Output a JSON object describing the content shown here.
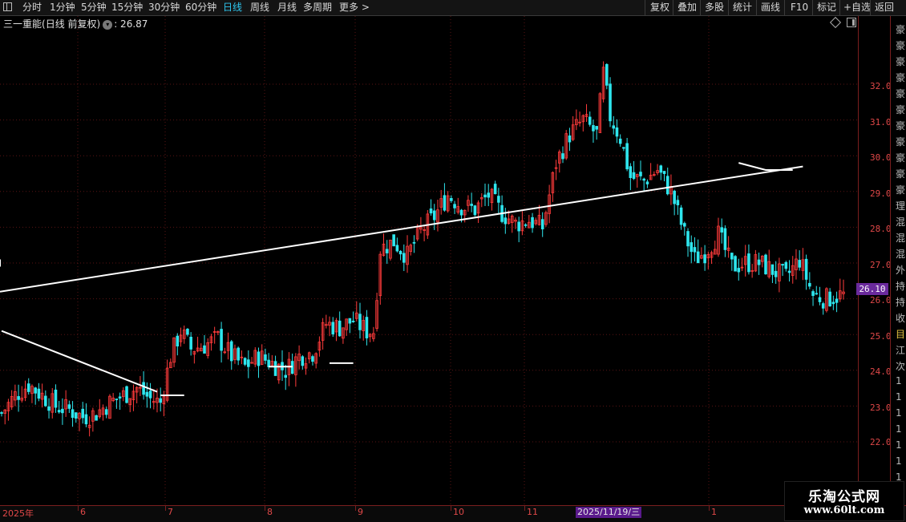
{
  "toolbar": {
    "periods": [
      "分时",
      "1分钟",
      "5分钟",
      "15分钟",
      "30分钟",
      "60分钟",
      "日线",
      "周线",
      "月线",
      "多周期",
      "更多 >"
    ],
    "active_period": "日线",
    "actions": [
      "复权",
      "叠加",
      "多股",
      "统计",
      "画线",
      "F10",
      "标记",
      "+自选",
      "返回"
    ]
  },
  "header": {
    "stock_name": "三一重能",
    "period_label": "(日线 前复权)",
    "current_value": ": 26.87"
  },
  "y_axis": {
    "labels": [
      "32.00",
      "31.00",
      "30.00",
      "29.00",
      "28.00",
      "27.00",
      "26.00",
      "25.00",
      "24.00",
      "23.00",
      "22.00"
    ]
  },
  "price_tag": "26.10",
  "x_axis": {
    "labels": [
      "2025年",
      "6",
      "7",
      "8",
      "9",
      "10",
      "11",
      "1"
    ],
    "highlight_date": "2025/11/19/三"
  },
  "watermark": {
    "title": "乐淘公式网",
    "url": "www.60lt.com"
  },
  "colors": {
    "up": "#ff3b3b",
    "down": "#2ee6ee",
    "line": "#ffffff",
    "grid": "#5a1414",
    "axis": "#e04848",
    "active": "#2ec7f0"
  },
  "chart_data": {
    "type": "candlestick",
    "ylim": [
      21.1,
      33.5
    ],
    "count": 250,
    "anchors": [
      [
        0,
        22.8
      ],
      [
        4,
        23.3
      ],
      [
        8,
        23.6
      ],
      [
        12,
        23.3
      ],
      [
        16,
        23.0
      ],
      [
        20,
        22.9
      ],
      [
        24,
        22.7
      ],
      [
        28,
        22.8
      ],
      [
        32,
        23.1
      ],
      [
        36,
        23.3
      ],
      [
        40,
        23.5
      ],
      [
        44,
        23.2
      ],
      [
        47,
        23.1
      ],
      [
        50,
        24.4
      ],
      [
        53,
        25.1
      ],
      [
        56,
        24.6
      ],
      [
        60,
        24.7
      ],
      [
        64,
        24.9
      ],
      [
        68,
        24.4
      ],
      [
        72,
        24.1
      ],
      [
        76,
        24.4
      ],
      [
        80,
        24.2
      ],
      [
        84,
        24.0
      ],
      [
        88,
        24.4
      ],
      [
        92,
        24.5
      ],
      [
        96,
        25.3
      ],
      [
        100,
        25.2
      ],
      [
        104,
        25.4
      ],
      [
        108,
        25.1
      ],
      [
        110,
        25.1
      ],
      [
        112,
        27.4
      ],
      [
        116,
        27.6
      ],
      [
        120,
        27.2
      ],
      [
        124,
        27.9
      ],
      [
        128,
        28.3
      ],
      [
        132,
        28.9
      ],
      [
        136,
        28.6
      ],
      [
        140,
        28.5
      ],
      [
        144,
        28.9
      ],
      [
        148,
        28.4
      ],
      [
        152,
        28.1
      ],
      [
        156,
        28.2
      ],
      [
        160,
        28.0
      ],
      [
        164,
        29.8
      ],
      [
        168,
        30.6
      ],
      [
        172,
        31.0
      ],
      [
        176,
        30.6
      ],
      [
        178,
        32.3
      ],
      [
        180,
        31.1
      ],
      [
        183,
        30.5
      ],
      [
        186,
        29.4
      ],
      [
        190,
        29.3
      ],
      [
        194,
        29.6
      ],
      [
        198,
        29.0
      ],
      [
        202,
        27.8
      ],
      [
        205,
        27.1
      ],
      [
        208,
        27.3
      ],
      [
        212,
        27.8
      ],
      [
        216,
        26.9
      ],
      [
        220,
        27.0
      ],
      [
        224,
        27.0
      ],
      [
        228,
        26.8
      ],
      [
        232,
        26.6
      ],
      [
        236,
        27.1
      ],
      [
        240,
        26.1
      ],
      [
        244,
        26.0
      ],
      [
        248,
        26.1
      ],
      [
        249,
        26.1
      ]
    ],
    "lines": [
      {
        "name": "segment-1",
        "points": [
          [
            0,
            25.1
          ],
          [
            46,
            23.4
          ]
        ]
      },
      {
        "name": "segment-2",
        "points": [
          [
            47,
            23.3
          ],
          [
            54,
            23.3
          ]
        ]
      },
      {
        "name": "segment-3",
        "points": [
          [
            79,
            24.1
          ],
          [
            86,
            24.1
          ]
        ]
      },
      {
        "name": "segment-4",
        "points": [
          [
            97,
            24.2
          ],
          [
            104,
            24.2
          ]
        ]
      },
      {
        "name": "segment-5",
        "points": [
          [
            218,
            29.8
          ],
          [
            226,
            29.6
          ],
          [
            234,
            29.6
          ]
        ]
      },
      {
        "name": "segment-6",
        "points": [
          [
            237,
            29.7
          ],
          [
            327,
            26.2
          ]
        ]
      },
      {
        "name": "segment-7",
        "points": [
          [
            362,
            27.0
          ],
          [
            369,
            26.9
          ]
        ]
      },
      {
        "name": "segment-8",
        "points": [
          [
            377,
            27.1
          ],
          [
            386,
            26.9
          ]
        ]
      }
    ]
  }
}
